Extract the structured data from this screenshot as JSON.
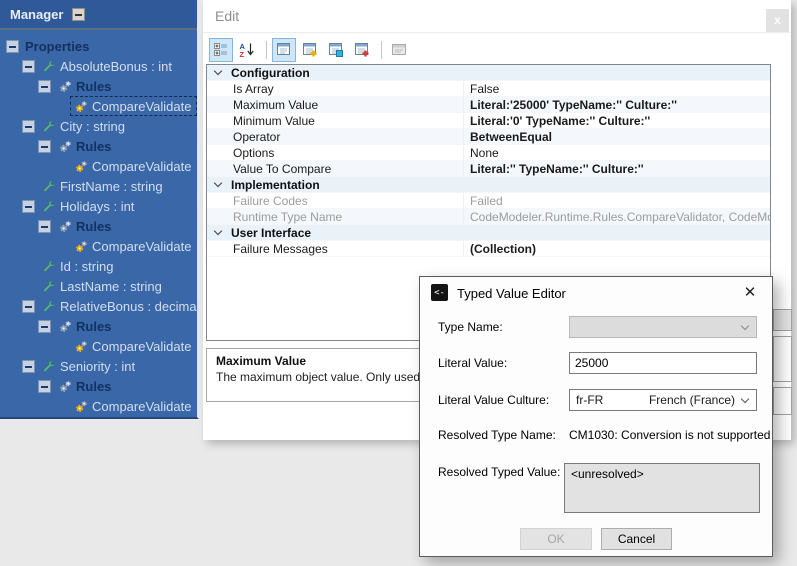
{
  "colors": {
    "tree_background": "#3a67a8",
    "tree_titlebar": "#30599a",
    "tree_section_text": "#14305e",
    "tree_item_text": "#d3deee",
    "toolbar_selected_bg": "#cfe6f8",
    "toolbar_selected_border": "#84b6de",
    "category_row_bg": "#e9f1f9",
    "disabled_fill": "#dcdcdc"
  },
  "tree_panel": {
    "title": "Manager",
    "nodes": [
      {
        "label": "Properties",
        "indent": 0,
        "expander": true,
        "icon": "",
        "style": "section"
      },
      {
        "label": "AbsoluteBonus : int",
        "indent": 1,
        "expander": true,
        "icon": "wrench",
        "style": "item"
      },
      {
        "label": "Rules",
        "indent": 2,
        "expander": true,
        "icon": "gears-gray",
        "style": "section"
      },
      {
        "label": "CompareValidate",
        "indent": 3,
        "expander": false,
        "icon": "gears-gold",
        "style": "item",
        "selected": true
      },
      {
        "label": "City : string",
        "indent": 1,
        "expander": true,
        "icon": "wrench",
        "style": "item"
      },
      {
        "label": "Rules",
        "indent": 2,
        "expander": true,
        "icon": "gears-gray",
        "style": "section"
      },
      {
        "label": "CompareValidate",
        "indent": 3,
        "expander": false,
        "icon": "gears-gold",
        "style": "item"
      },
      {
        "label": "FirstName : string",
        "indent": 1,
        "expander": false,
        "icon": "wrench",
        "style": "item"
      },
      {
        "label": "Holidays : int",
        "indent": 1,
        "expander": true,
        "icon": "wrench",
        "style": "item"
      },
      {
        "label": "Rules",
        "indent": 2,
        "expander": true,
        "icon": "gears-gray",
        "style": "section"
      },
      {
        "label": "CompareValidate",
        "indent": 3,
        "expander": false,
        "icon": "gears-gold",
        "style": "item"
      },
      {
        "label": "Id : string",
        "indent": 1,
        "expander": false,
        "icon": "wrench",
        "style": "item"
      },
      {
        "label": "LastName : string",
        "indent": 1,
        "expander": false,
        "icon": "wrench",
        "style": "item"
      },
      {
        "label": "RelativeBonus : decimal",
        "indent": 1,
        "expander": true,
        "icon": "wrench",
        "style": "item"
      },
      {
        "label": "Rules",
        "indent": 2,
        "expander": true,
        "icon": "gears-gray",
        "style": "section"
      },
      {
        "label": "CompareValidate",
        "indent": 3,
        "expander": false,
        "icon": "gears-gold",
        "style": "item"
      },
      {
        "label": "Seniority : int",
        "indent": 1,
        "expander": true,
        "icon": "wrench",
        "style": "item"
      },
      {
        "label": "Rules",
        "indent": 2,
        "expander": true,
        "icon": "gears-gray",
        "style": "section"
      },
      {
        "label": "CompareValidate",
        "indent": 3,
        "expander": false,
        "icon": "gears-gold",
        "style": "item"
      }
    ]
  },
  "edit_panel": {
    "header": {
      "title": "Edit",
      "close_label": "x"
    },
    "toolbar": {
      "buttons": [
        {
          "name": "categorized-view-button",
          "icon": "categorized",
          "state": "selected"
        },
        {
          "name": "alphabetical-sort-button",
          "icon": "az-sort",
          "state": "normal"
        },
        {
          "sep": true
        },
        {
          "name": "property-list-button",
          "icon": "list",
          "state": "selected"
        },
        {
          "name": "add-property-button",
          "icon": "list-add-yellow",
          "state": "normal"
        },
        {
          "name": "copy-property-button",
          "icon": "list-copy",
          "state": "normal"
        },
        {
          "name": "new-property-button",
          "icon": "list-add-red",
          "state": "normal"
        },
        {
          "sep": true
        },
        {
          "name": "property-pages-button",
          "icon": "property-page",
          "state": "disabled"
        }
      ]
    },
    "grid": {
      "rows": [
        {
          "type": "category",
          "label": "Configuration"
        },
        {
          "type": "property",
          "name": "Is Array",
          "value": "False",
          "bold": false
        },
        {
          "type": "property",
          "name": "Maximum Value",
          "value": "Literal:'25000' TypeName:'' Culture:''",
          "bold": true
        },
        {
          "type": "property",
          "name": "Minimum Value",
          "value": "Literal:'0' TypeName:'' Culture:''",
          "bold": true
        },
        {
          "type": "property",
          "name": "Operator",
          "value": "BetweenEqual",
          "bold": true
        },
        {
          "type": "property",
          "name": "Options",
          "value": "None",
          "bold": false
        },
        {
          "type": "property",
          "name": "Value To Compare",
          "value": "Literal:'' TypeName:'' Culture:''",
          "bold": true
        },
        {
          "type": "category",
          "label": "Implementation"
        },
        {
          "type": "property",
          "name": "Failure Codes",
          "value": "Failed",
          "bold": false,
          "readonly": true
        },
        {
          "type": "property",
          "name": "Runtime Type Name",
          "value": "CodeModeler.Runtime.Rules.CompareValidator, CodeModeler.Runtime",
          "bold": false,
          "readonly": true
        },
        {
          "type": "category",
          "label": "User Interface"
        },
        {
          "type": "property",
          "name": "Failure Messages",
          "value": "(Collection)",
          "bold": true
        }
      ]
    },
    "description": {
      "title": "Maximum Value",
      "text": "The maximum object value. Only used for bi"
    }
  },
  "dialog": {
    "title": "Typed Value Editor",
    "icon_glyph": "<-",
    "close_glyph": "✕",
    "fields": {
      "type_name": {
        "label": "Type Name:",
        "value": ""
      },
      "literal_value": {
        "label": "Literal Value:",
        "value": "25000"
      },
      "literal_value_culture": {
        "label": "Literal Value Culture:",
        "code": "fr-FR",
        "display": "French (France)"
      },
      "resolved_type_name": {
        "label": "Resolved Type Name:",
        "value": "CM1030: Conversion is not supported"
      },
      "resolved_typed_value": {
        "label": "Resolved Typed Value:",
        "value": "<unresolved>"
      }
    },
    "buttons": {
      "ok": "OK",
      "cancel": "Cancel"
    }
  }
}
